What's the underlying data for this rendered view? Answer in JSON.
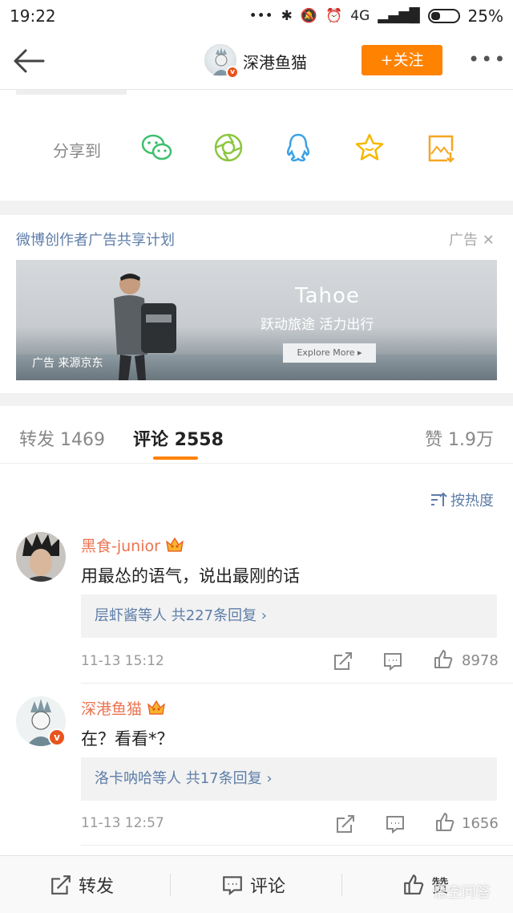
{
  "status_bar": {
    "time": "19:22",
    "network": "4G",
    "battery": "25%"
  },
  "header": {
    "user_name": "深港鱼猫",
    "follow_label": "+关注",
    "more_label": "•••"
  },
  "share": {
    "label": "分享到"
  },
  "ad": {
    "title": "微博创作者广告共享计划",
    "tag": "广告",
    "brand": "Tahoe",
    "slogan": "跃动旅途  活力出行",
    "explore": "Explore More  ▸",
    "source": "广告 来源京东"
  },
  "tabs": {
    "repost": "转发 1469",
    "comments": "评论 2558",
    "likes": "赞 1.9万"
  },
  "sort_label": "按热度",
  "comments": [
    {
      "name": "黑食-junior",
      "text": "用最怂的语气，说出最刚的话",
      "replies": "层虾酱等人  共227条回复 ›",
      "time": "11-13 15:12",
      "likes": "8978"
    },
    {
      "name": "深港鱼猫",
      "text": "在？看看*？",
      "replies": "洛卡呐哈等人  共17条回复 ›",
      "time": "11-13 12:57",
      "likes": "1656"
    }
  ],
  "bottom_bar": {
    "repost": "转发",
    "comment": "评论",
    "like": "赞"
  },
  "watermark": "悟空问答",
  "colors": {
    "accent": "#ff8200",
    "link": "#5d7da8",
    "name": "#eb7350"
  }
}
